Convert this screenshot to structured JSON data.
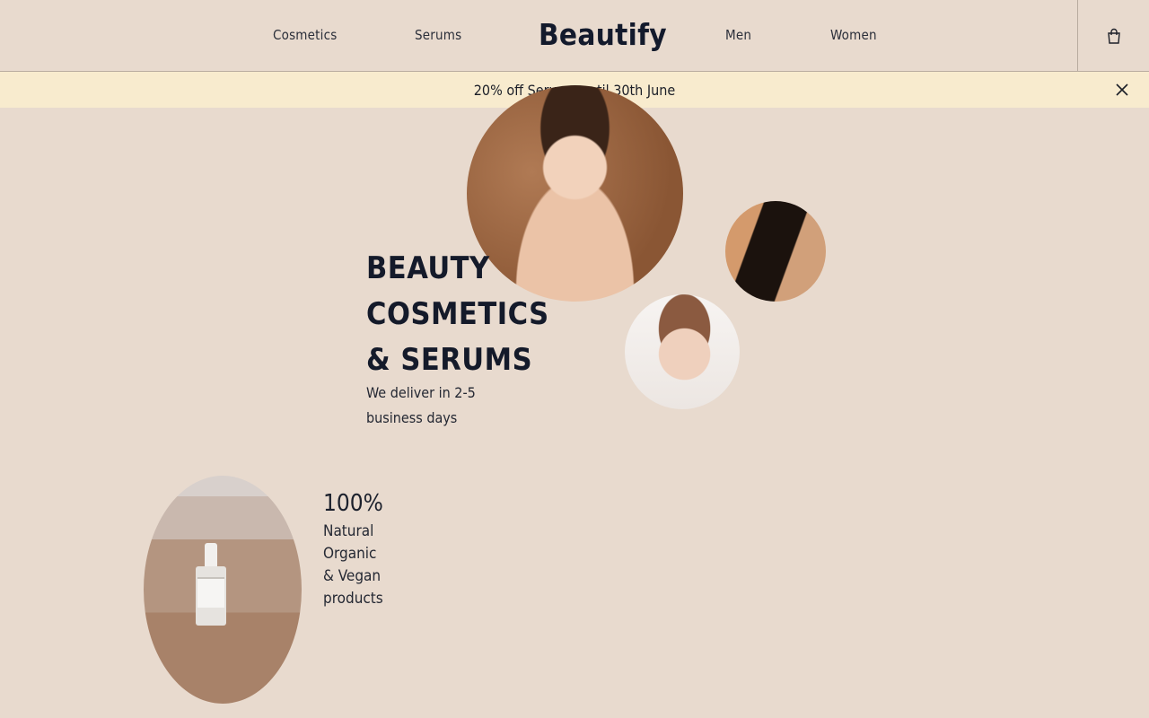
{
  "header": {
    "brand": "Beautify",
    "nav": [
      {
        "label": "Cosmetics"
      },
      {
        "label": "Serums"
      },
      {
        "label": "Men"
      },
      {
        "label": "Women"
      }
    ],
    "cart_icon": "shopping-bag-icon"
  },
  "promo": {
    "text": "20% off Serums until 30th June",
    "close_icon": "close-icon",
    "background": "#f8ebce"
  },
  "hero": {
    "title_lines": [
      "BEAUTY",
      "COSMETICS",
      "& SERUMS"
    ],
    "subtitle": "We deliver in 2-5 business days"
  },
  "feature": {
    "stat": "100%",
    "lines": [
      "Natural",
      "Organic",
      "& Vegan",
      "products"
    ]
  },
  "colors": {
    "page_background": "#e8dace",
    "text_dark": "#141a2a"
  }
}
